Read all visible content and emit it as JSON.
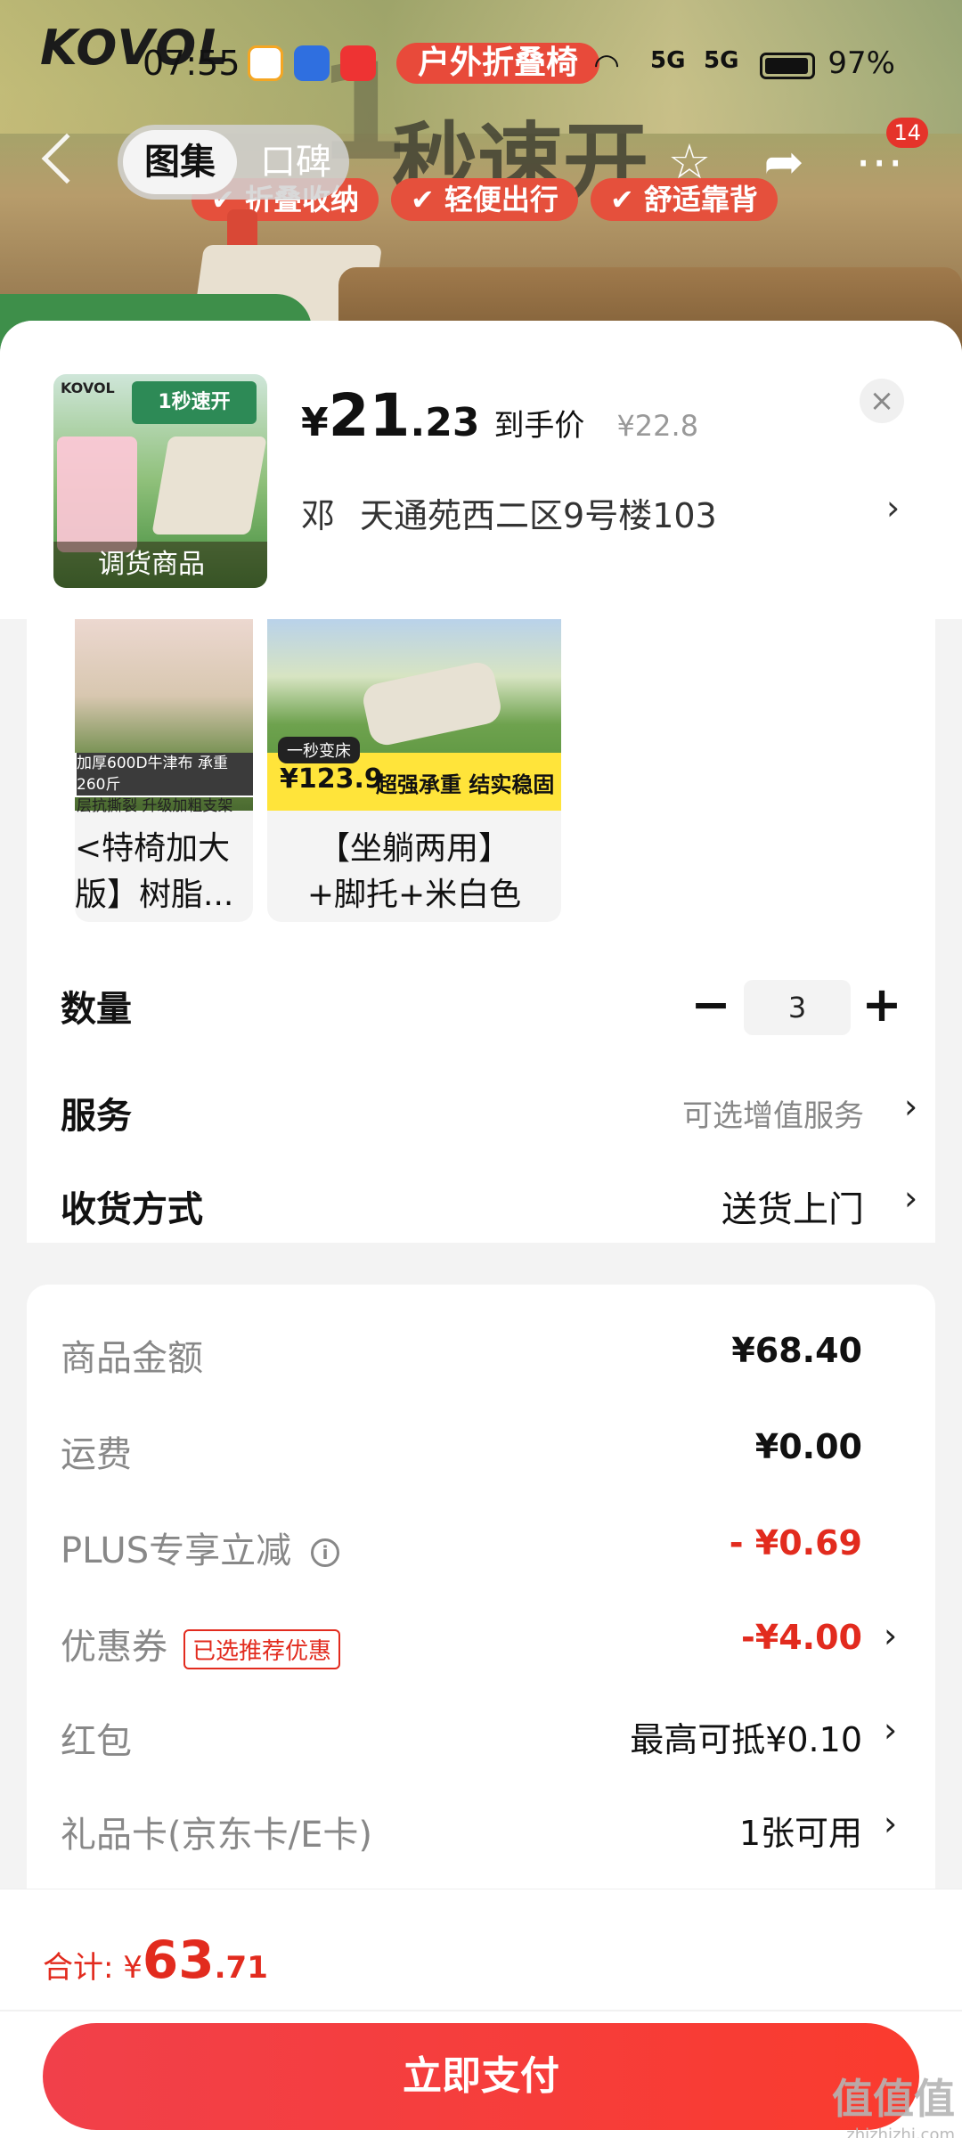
{
  "hero": {
    "brand": "KOVOL",
    "tag": "户外折叠椅",
    "title_num": "1",
    "title": "秒速开",
    "chips": [
      "✔ 折叠收纳",
      "✔ 轻便出行",
      "✔ 舒适靠背"
    ]
  },
  "status_bar": {
    "time": "07:55",
    "network1": "5G",
    "network2": "5G",
    "battery_pct": "97%"
  },
  "nav": {
    "tabs": [
      "图集",
      "口碑"
    ],
    "badge_count": "14"
  },
  "product": {
    "thumb_label": "调货商品",
    "thumb_brand": "KOVOL",
    "thumb_head": "1秒速开",
    "price_currency": "¥",
    "price_int": "21",
    "price_dec": ".23",
    "price_label": "到手价",
    "price_old": "¥22.8",
    "close": "×",
    "addr_name": "邓",
    "addr_text": "天通苑西二区9号楼103"
  },
  "variants": [
    {
      "strip_top": "加厚600D牛津布 承重260斤",
      "strip_bottom": "层抗撕裂 升级加粗支架",
      "text": "<特椅加大\n版】树脂..."
    },
    {
      "tag": "一秒变床",
      "price": "¥123.9",
      "slogan": "超强承重 结实稳固",
      "text": "【坐躺两用】\n+脚托+米白色"
    }
  ],
  "quantity": {
    "label": "数量",
    "value": "3",
    "minus": "−",
    "plus": "+"
  },
  "service": {
    "label": "服务",
    "value": "可选增值服务"
  },
  "delivery": {
    "label": "收货方式",
    "value": "送货上门"
  },
  "summary": {
    "goods_label": "商品金额",
    "goods_value": "¥68.40",
    "freight_label": "运费",
    "freight_value": "¥0.00",
    "plus_label": "PLUS专享立减",
    "plus_value": "- ¥0.69",
    "coupon_label": "优惠券",
    "coupon_tag": "已选推荐优惠",
    "coupon_value": "-¥4.00",
    "redpack_label": "红包",
    "redpack_value": "最高可抵¥0.10",
    "giftcard_label": "礼品卡(京东卡/E卡)",
    "giftcard_value": "1张可用"
  },
  "footer": {
    "total_label": "合计: ¥",
    "total_int": "63",
    "total_dec": ".71",
    "pay_button": "立即支付",
    "watermark": "值值值",
    "watermark_url": "zhizhizhi.com"
  },
  "colors": {
    "accent": "#e22b1e",
    "pay_button": "#f5383d",
    "hero_tag": "#e84a3a"
  }
}
